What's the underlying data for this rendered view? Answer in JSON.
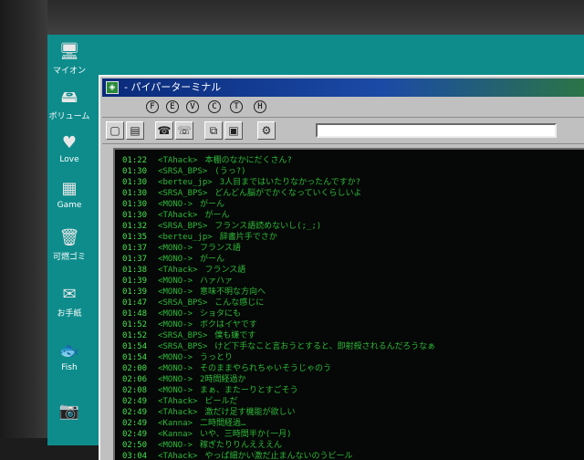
{
  "desktop_icons": [
    {
      "name": "my-computer-icon",
      "glyph": "🖥",
      "label": "マイオン"
    },
    {
      "name": "volume-icon",
      "glyph": "🖴",
      "label": "ボリューム"
    },
    {
      "name": "love-icon",
      "glyph": "♥",
      "label": "Love"
    },
    {
      "name": "game-icon",
      "glyph": "▦",
      "label": "Game"
    },
    {
      "name": "trash-icon",
      "glyph": "🗑",
      "label": "可燃ゴミ"
    },
    {
      "name": "mail-icon",
      "glyph": "✉",
      "label": "お手紙"
    },
    {
      "name": "fish-icon",
      "glyph": "🐟",
      "label": "Fish"
    },
    {
      "name": "camera-icon",
      "glyph": "📷",
      "label": ""
    }
  ],
  "window": {
    "title": "- パイパーターミナル",
    "menu": [
      "F",
      "E",
      "V",
      "C",
      "T",
      "H"
    ],
    "toolbar_icons": [
      "new-document-icon",
      "open-icon",
      "phone-icon",
      "hangup-icon",
      "copy-icon",
      "paste-icon",
      "settings-icon"
    ],
    "address_value": ""
  },
  "console_lines": [
    {
      "time": "01:22",
      "nick": "<TAhack>",
      "msg": "本棚のなかにだくさん?"
    },
    {
      "time": "01:30",
      "nick": "<SRSA_BPS>",
      "msg": "(うっ?)"
    },
    {
      "time": "01:30",
      "nick": "<berteu_jp>",
      "msg": "3人目まではいたりなかったんですか?"
    },
    {
      "time": "01:30",
      "nick": "<SRSA_BPS>",
      "msg": "どんどん脳がでかくなっていくらしいよ"
    },
    {
      "time": "01:30",
      "nick": "<MONO->",
      "msg": "がーん"
    },
    {
      "time": "01:30",
      "nick": "<TAhack>",
      "msg": "がーん"
    },
    {
      "time": "01:32",
      "nick": "<SRSA_BPS>",
      "msg": "フランス語読めないし(;_;)"
    },
    {
      "time": "01:35",
      "nick": "<berteu_jp>",
      "msg": "辞書片手でさか"
    },
    {
      "time": "01:37",
      "nick": "<MONO->",
      "msg": "フランス語"
    },
    {
      "time": "01:37",
      "nick": "<MONO->",
      "msg": "がーん"
    },
    {
      "time": "01:38",
      "nick": "<TAhack>",
      "msg": "フランス語"
    },
    {
      "time": "01:39",
      "nick": "<MONO->",
      "msg": "ハァハァ"
    },
    {
      "time": "01:39",
      "nick": "<MONO->",
      "msg": "意味不明な方向へ"
    },
    {
      "time": "01:47",
      "nick": "<SRSA_BPS>",
      "msg": "こんな感じに"
    },
    {
      "time": "01:48",
      "nick": "<MONO->",
      "msg": "ショタにも"
    },
    {
      "time": "01:52",
      "nick": "<MONO->",
      "msg": "ボクはイヤです"
    },
    {
      "time": "01:52",
      "nick": "<SRSA_BPS>",
      "msg": "僕も嫌です"
    },
    {
      "time": "01:54",
      "nick": "<SRSA_BPS>",
      "msg": "けど下手なこと言おうとすると、即射殺されるんだろうなぁ"
    },
    {
      "time": "01:54",
      "nick": "<MONO->",
      "msg": "うっとり"
    },
    {
      "time": "02:00",
      "nick": "<MONO->",
      "msg": "そのままやられちゃいそうじゃのう"
    },
    {
      "time": "02:06",
      "nick": "<MONO->",
      "msg": "2時間経過か"
    },
    {
      "time": "02:08",
      "nick": "<MONO->",
      "msg": "まぁ、またーりとすごそう"
    },
    {
      "time": "02:49",
      "nick": "<TAhack>",
      "msg": "ビールだ"
    },
    {
      "time": "02:49",
      "nick": "<TAhack>",
      "msg": "激だけ足す機能が欲しい"
    },
    {
      "time": "02:49",
      "nick": "<Kanna>",
      "msg": "二時間経過…"
    },
    {
      "time": "02:49",
      "nick": "<Kanna>",
      "msg": "いや、三時間半か(一月)"
    },
    {
      "time": "02:50",
      "nick": "<MONO->",
      "msg": "稼ぎたりりんえええん"
    },
    {
      "time": "03:04",
      "nick": "<TAhack>",
      "msg": "やっぱ細かい激だ止まんないのうビール"
    }
  ]
}
